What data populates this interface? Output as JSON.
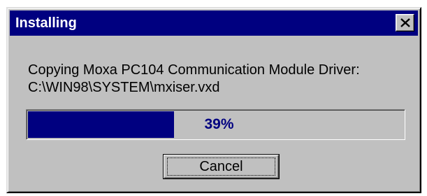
{
  "window": {
    "title": "Installing",
    "close_icon": "close-icon"
  },
  "message": {
    "line1": "Copying Moxa PC104 Communication Module Driver:",
    "line2": "C:\\WIN98\\SYSTEM\\mxiser.vxd"
  },
  "progress": {
    "value": 0.39,
    "label": "39%",
    "fill_color": "#000080",
    "text_color": "#000080"
  },
  "buttons": {
    "cancel_label": "Cancel"
  },
  "colors": {
    "title_bar": "#000080",
    "dialog_face": "#c0c0c0"
  }
}
